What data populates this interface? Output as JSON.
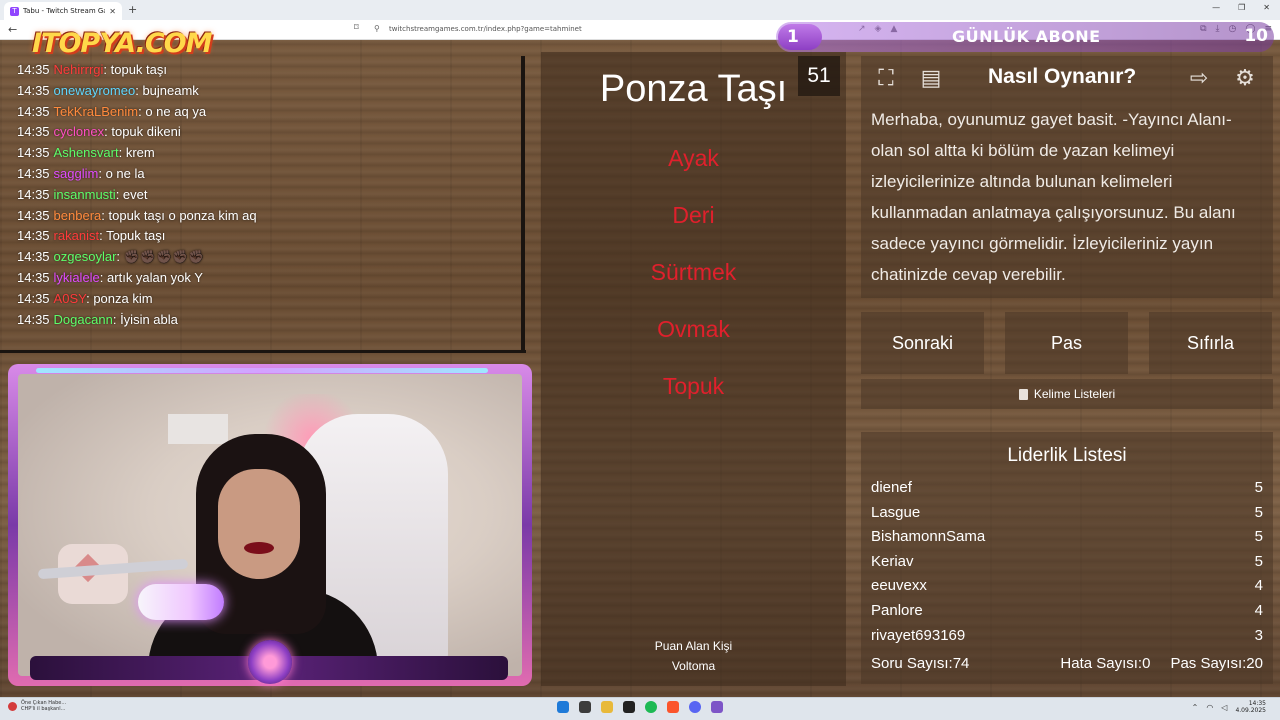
{
  "browser": {
    "tab_title": "Tabu - Twitch Stream Games",
    "tab_favicon": "T",
    "url": "twitchstreamgames.com.tr/index.php?game=tahminet"
  },
  "overlay": {
    "logo": "ITOPYA.COM",
    "subscriber_widget": {
      "title": "GÜNLÜK ABONE",
      "current": "1",
      "goal": "10"
    }
  },
  "chat": {
    "messages": [
      {
        "time": "14:35",
        "user": "Nehirrrgi",
        "color": "#ff3b3b",
        "text": " topuk taşı"
      },
      {
        "time": "14:35",
        "user": "onewayromeo",
        "color": "#5fd7ff",
        "text": " bujneamk"
      },
      {
        "time": "14:35",
        "user": "TekKraLBenim",
        "color": "#ff8a3d",
        "text": " o ne aq ya"
      },
      {
        "time": "14:35",
        "user": "cyclonex",
        "color": "#ff4fc3",
        "text": " topuk dikeni"
      },
      {
        "time": "14:35",
        "user": "Ashensvart",
        "color": "#5dff6a",
        "text": " krem"
      },
      {
        "time": "14:35",
        "user": "sagglim",
        "color": "#e04bff",
        "text": " o ne la"
      },
      {
        "time": "14:35",
        "user": "insanmusti",
        "color": "#5dff6a",
        "text": " evet"
      },
      {
        "time": "14:35",
        "user": "benbera",
        "color": "#ff8a3d",
        "text": " topuk taşı o ponza kim aq"
      },
      {
        "time": "14:35",
        "user": "rakanist",
        "color": "#ff3b3b",
        "text": " Topuk taşı"
      },
      {
        "time": "14:35",
        "user": "ozgesoylar",
        "color": "#5dff6a",
        "text": " ✊🏿✊🏿✊🏿✊🏿✊🏿"
      },
      {
        "time": "14:35",
        "user": "lykialele",
        "color": "#e04bff",
        "text": " artık yalan yok Y"
      },
      {
        "time": "14:35",
        "user": "A0SY",
        "color": "#ff3b3b",
        "text": " ponza kim"
      },
      {
        "time": "14:35",
        "user": "Dogacann",
        "color": "#5dff6a",
        "text": " İyisin abla"
      }
    ]
  },
  "game": {
    "timer": "51",
    "main_word": "Ponza Taşı",
    "taboo_words": [
      "Ayak",
      "Deri",
      "Sürtmek",
      "Ovmak",
      "Topuk"
    ],
    "scorer_label": "Puan Alan Kişi",
    "scorer_name": "Voltoma"
  },
  "how_to": {
    "title": "Nasıl Oynanır?",
    "text": "Merhaba, oyunumuz gayet basit. -Yayıncı Alanı- olan sol altta ki bölüm de yazan kelimeyi izleyicilerinize altında bulunan kelimeleri kullanmadan anlatmaya çalışıyorsunuz. Bu alanı sadece yayıncı görmelidir. İzleyicileriniz yayın chatinizde cevap verebilir.",
    "icons": [
      "fullscreen-icon",
      "notes-icon",
      "exit-icon",
      "settings-icon"
    ]
  },
  "controls": {
    "next": "Sonraki",
    "pass": "Pas",
    "reset": "Sıfırla",
    "word_lists": "Kelime Listeleri"
  },
  "leaderboard": {
    "title": "Liderlik Listesi",
    "rows": [
      {
        "name": "dienef",
        "score": "5"
      },
      {
        "name": "Lasgue",
        "score": "5"
      },
      {
        "name": "BishamonnSama",
        "score": "5"
      },
      {
        "name": "Keriav",
        "score": "5"
      },
      {
        "name": "eeuvexx",
        "score": "4"
      },
      {
        "name": "Panlore",
        "score": "4"
      },
      {
        "name": "rivayet693169",
        "score": "3"
      }
    ],
    "question_count": "Soru Sayısı:74",
    "error_count": "Hata Sayısı:0",
    "pass_count": "Pas Sayısı:20"
  },
  "taskbar": {
    "news_line1": "Öne Çıkan Habe...",
    "news_line2": "CHP'li il başkanl...",
    "time": "14:35",
    "date": "4.09.2025"
  }
}
